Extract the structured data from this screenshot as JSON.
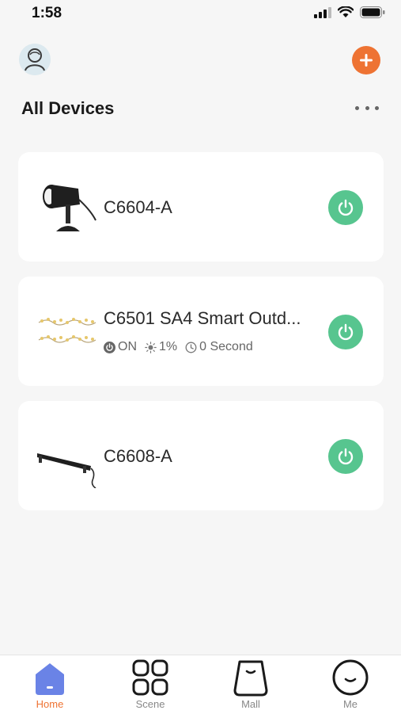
{
  "status_bar": {
    "time": "1:58"
  },
  "header": {
    "title": "All Devices"
  },
  "devices": [
    {
      "name": "C6604-A"
    },
    {
      "name": "C6501 SA4 Smart Outd...",
      "status": {
        "power": "ON",
        "brightness": "1%",
        "timer": "0 Second"
      }
    },
    {
      "name": "C6608-A"
    }
  ],
  "tabs": [
    {
      "label": "Home",
      "active": true
    },
    {
      "label": "Scene"
    },
    {
      "label": "Mall"
    },
    {
      "label": "Me"
    }
  ],
  "colors": {
    "accent": "#ee7333",
    "power_on": "#57c58f",
    "background": "#f6f6f6",
    "card": "#ffffff"
  },
  "icons": [
    "avatar-icon",
    "plus-icon",
    "more-dots-icon",
    "power-icon",
    "home-icon",
    "scene-icon",
    "mall-icon",
    "me-icon"
  ]
}
